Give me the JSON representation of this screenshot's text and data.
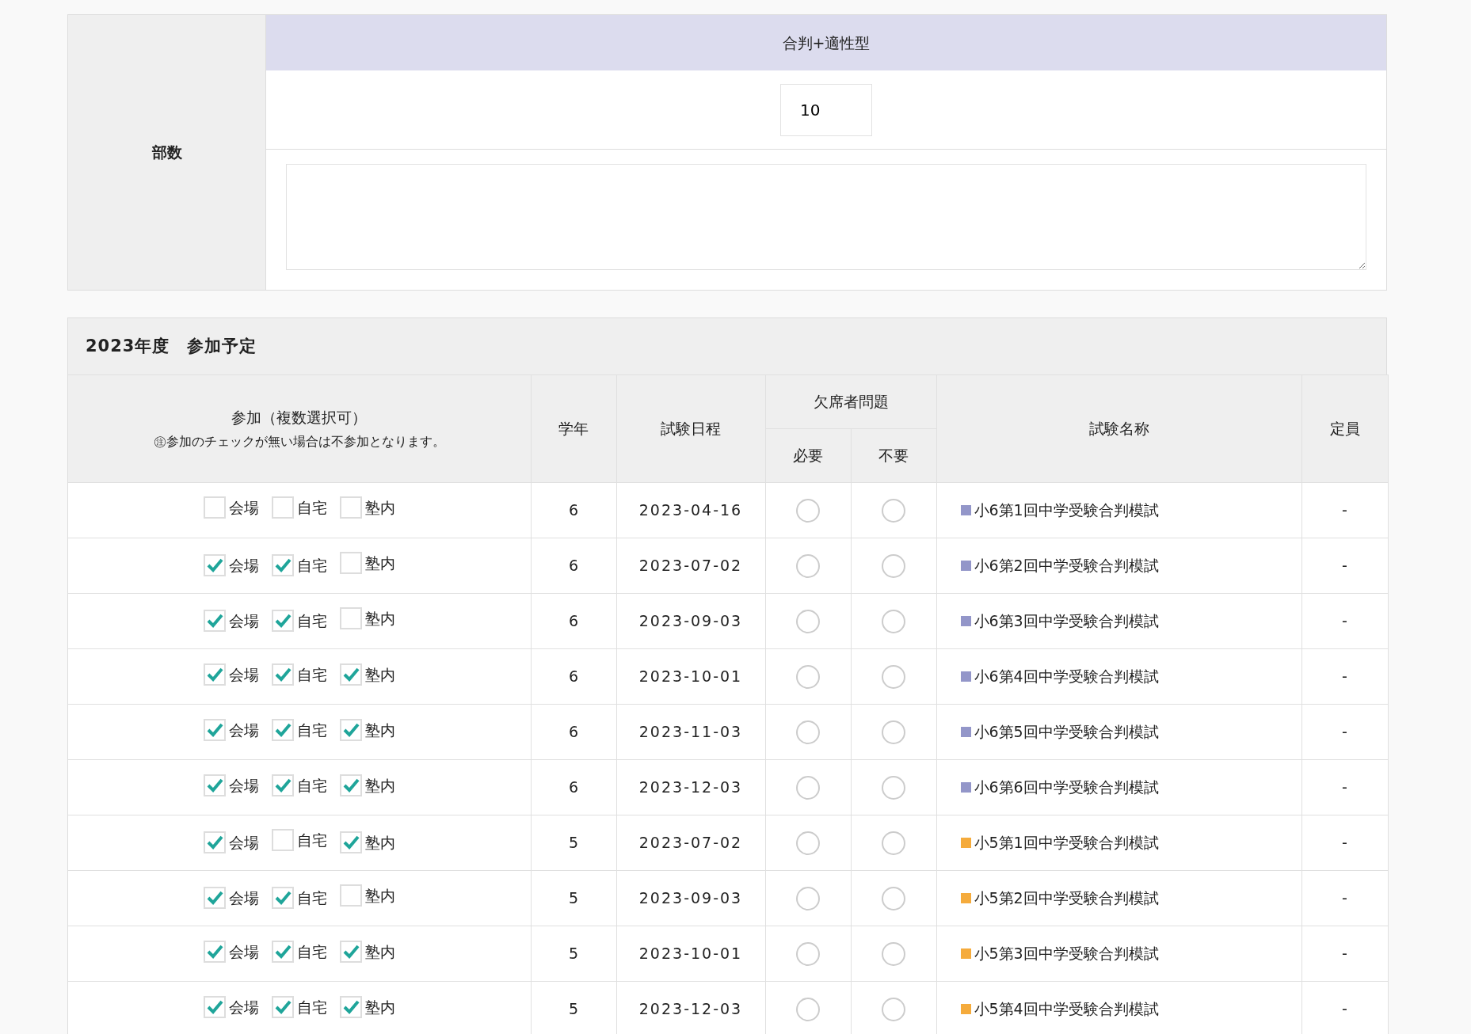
{
  "copies": {
    "label": "部数",
    "header": "合判+適性型",
    "value": "10"
  },
  "schedule": {
    "title": "2023年度　参加予定",
    "columns": {
      "participation": "参加（複数選択可）",
      "note": "㊟参加のチェックが無い場合は不参加となります。",
      "grade": "学年",
      "date": "試験日程",
      "absentee": "欠席者問題",
      "required": "必要",
      "not_required": "不要",
      "name": "試験名称",
      "capacity": "定員"
    },
    "rows": [
      {
        "options": [
          {
            "label": "会場",
            "checked": false
          },
          {
            "label": "自宅",
            "checked": false
          },
          {
            "label": "塾内",
            "checked": false
          }
        ],
        "grade": "6",
        "date": "2023-04-16",
        "required": {
          "selected": false
        },
        "not_required": {
          "selected": false
        },
        "name": "小6第1回中学受験合判模試",
        "color": "#9396c9",
        "capacity": "-"
      },
      {
        "options": [
          {
            "label": "会場",
            "checked": true
          },
          {
            "label": "自宅",
            "checked": true
          },
          {
            "label": "塾内",
            "checked": false
          }
        ],
        "grade": "6",
        "date": "2023-07-02",
        "required": {
          "selected": false
        },
        "not_required": {
          "selected": false
        },
        "name": "小6第2回中学受験合判模試",
        "color": "#9396c9",
        "capacity": "-"
      },
      {
        "options": [
          {
            "label": "会場",
            "checked": true
          },
          {
            "label": "自宅",
            "checked": true
          },
          {
            "label": "塾内",
            "checked": false
          }
        ],
        "grade": "6",
        "date": "2023-09-03",
        "required": {
          "selected": false
        },
        "not_required": {
          "selected": false
        },
        "name": "小6第3回中学受験合判模試",
        "color": "#9396c9",
        "capacity": "-"
      },
      {
        "options": [
          {
            "label": "会場",
            "checked": true
          },
          {
            "label": "自宅",
            "checked": true
          },
          {
            "label": "塾内",
            "checked": true
          }
        ],
        "grade": "6",
        "date": "2023-10-01",
        "required": {
          "selected": false
        },
        "not_required": {
          "selected": false
        },
        "name": "小6第4回中学受験合判模試",
        "color": "#9396c9",
        "capacity": "-"
      },
      {
        "options": [
          {
            "label": "会場",
            "checked": true
          },
          {
            "label": "自宅",
            "checked": true
          },
          {
            "label": "塾内",
            "checked": true
          }
        ],
        "grade": "6",
        "date": "2023-11-03",
        "required": {
          "selected": false
        },
        "not_required": {
          "selected": false
        },
        "name": "小6第5回中学受験合判模試",
        "color": "#9396c9",
        "capacity": "-"
      },
      {
        "options": [
          {
            "label": "会場",
            "checked": true
          },
          {
            "label": "自宅",
            "checked": true
          },
          {
            "label": "塾内",
            "checked": true
          }
        ],
        "grade": "6",
        "date": "2023-12-03",
        "required": {
          "selected": false
        },
        "not_required": {
          "selected": false
        },
        "name": "小6第6回中学受験合判模試",
        "color": "#9396c9",
        "capacity": "-"
      },
      {
        "options": [
          {
            "label": "会場",
            "checked": true
          },
          {
            "label": "自宅",
            "checked": false
          },
          {
            "label": "塾内",
            "checked": true
          }
        ],
        "grade": "5",
        "date": "2023-07-02",
        "required": {
          "selected": false
        },
        "not_required": {
          "selected": false
        },
        "name": "小5第1回中学受験合判模試",
        "color": "#f5ab3c",
        "capacity": "-"
      },
      {
        "options": [
          {
            "label": "会場",
            "checked": true
          },
          {
            "label": "自宅",
            "checked": true
          },
          {
            "label": "塾内",
            "checked": false
          }
        ],
        "grade": "5",
        "date": "2023-09-03",
        "required": {
          "selected": false
        },
        "not_required": {
          "selected": false
        },
        "name": "小5第2回中学受験合判模試",
        "color": "#f5ab3c",
        "capacity": "-"
      },
      {
        "options": [
          {
            "label": "会場",
            "checked": true
          },
          {
            "label": "自宅",
            "checked": true
          },
          {
            "label": "塾内",
            "checked": true
          }
        ],
        "grade": "5",
        "date": "2023-10-01",
        "required": {
          "selected": false
        },
        "not_required": {
          "selected": false
        },
        "name": "小5第3回中学受験合判模試",
        "color": "#f5ab3c",
        "capacity": "-"
      },
      {
        "options": [
          {
            "label": "会場",
            "checked": true
          },
          {
            "label": "自宅",
            "checked": true
          },
          {
            "label": "塾内",
            "checked": true
          }
        ],
        "grade": "5",
        "date": "2023-12-03",
        "required": {
          "selected": false
        },
        "not_required": {
          "selected": false
        },
        "name": "小5第4回中学受験合判模試",
        "color": "#f5ab3c",
        "capacity": "-"
      }
    ]
  }
}
